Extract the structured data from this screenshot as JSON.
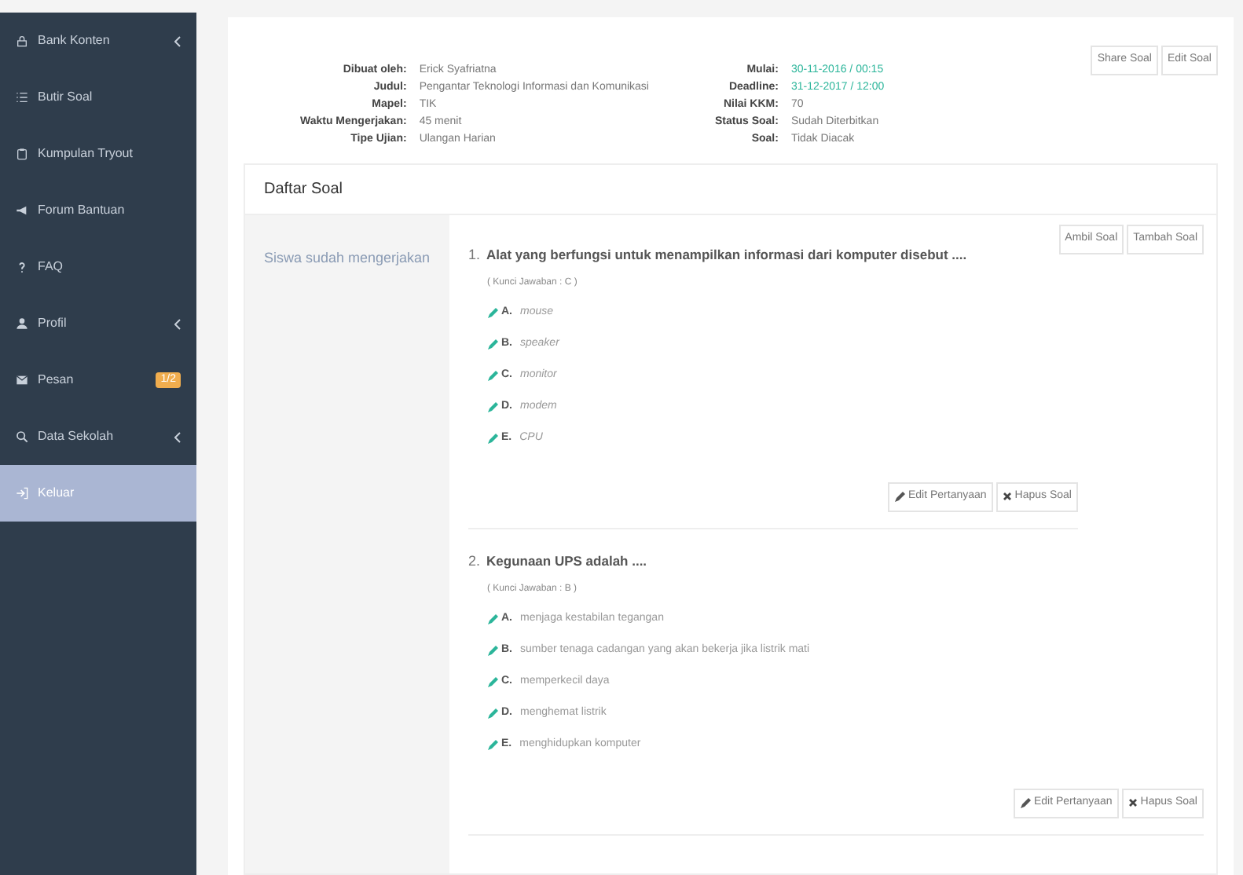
{
  "sidebar": {
    "items": [
      {
        "label": "Bank Konten",
        "has_submenu": true,
        "selected": false
      },
      {
        "label": "Butir Soal",
        "has_submenu": false,
        "selected": false
      },
      {
        "label": "Kumpulan Tryout",
        "has_submenu": false,
        "selected": false
      },
      {
        "label": "Forum Bantuan",
        "has_submenu": false,
        "selected": false
      },
      {
        "label": "FAQ",
        "has_submenu": false,
        "selected": false
      },
      {
        "label": "Profil",
        "has_submenu": true,
        "selected": false
      },
      {
        "label": "Pesan",
        "has_submenu": false,
        "selected": false,
        "badge": "1/2"
      },
      {
        "label": "Data Sekolah",
        "has_submenu": true,
        "selected": false
      },
      {
        "label": "Keluar",
        "has_submenu": false,
        "selected": true
      }
    ]
  },
  "info": {
    "left": [
      {
        "label": "Dibuat oleh:",
        "value": "Erick Syafriatna"
      },
      {
        "label": "Judul:",
        "value": "Pengantar Teknologi Informasi dan Komunikasi"
      },
      {
        "label": "Mapel:",
        "value": "TIK"
      },
      {
        "label": "Waktu Mengerjakan:",
        "value": "45 menit"
      },
      {
        "label": "Tipe Ujian:",
        "value": "Ulangan Harian"
      }
    ],
    "right": [
      {
        "label": "Mulai:",
        "value": "30-11-2016 / 00:15",
        "highlight": true
      },
      {
        "label": "Deadline:",
        "value": "31-12-2017 / 12:00",
        "highlight": true
      },
      {
        "label": "Nilai KKM:",
        "value": "70",
        "highlight": false
      },
      {
        "label": "Status Soal:",
        "value": "Sudah Diterbitkan",
        "highlight": false
      },
      {
        "label": "Soal:",
        "value": "Tidak Diacak",
        "highlight": false
      }
    ],
    "buttons": [
      "Share Soal",
      "Edit Soal"
    ]
  },
  "question_list": {
    "title": "Daftar Soal",
    "side_link": "Siswa sudah mengerjakan",
    "buttons": [
      "Ambil Soal",
      "Tambah Soal"
    ],
    "questions": [
      {
        "number": "1.",
        "text": "Alat yang berfungsi untuk menampilkan informasi dari komputer disebut ....",
        "key": "( Kunci Jawaban : C )",
        "italic_options": true,
        "options": [
          {
            "letter": "A.",
            "text": "mouse"
          },
          {
            "letter": "B.",
            "text": "speaker"
          },
          {
            "letter": "C.",
            "text": "monitor"
          },
          {
            "letter": "D.",
            "text": "modem"
          },
          {
            "letter": "E.",
            "text": "CPU"
          }
        ],
        "edit": "Edit Pertanyaan",
        "delete": "Hapus Soal"
      },
      {
        "number": "2.",
        "text": "Kegunaan UPS adalah ....",
        "key": "( Kunci Jawaban : B )",
        "italic_options": false,
        "options": [
          {
            "letter": "A.",
            "text": "menjaga kestabilan tegangan"
          },
          {
            "letter": "B.",
            "text": "sumber tenaga cadangan yang akan bekerja jika listrik mati"
          },
          {
            "letter": "C.",
            "text": "memperkecil daya"
          },
          {
            "letter": "D.",
            "text": "menghemat listrik"
          },
          {
            "letter": "E.",
            "text": "menghidupkan komputer"
          }
        ],
        "edit": "Edit Pertanyaan",
        "delete": "Hapus Soal"
      }
    ]
  }
}
